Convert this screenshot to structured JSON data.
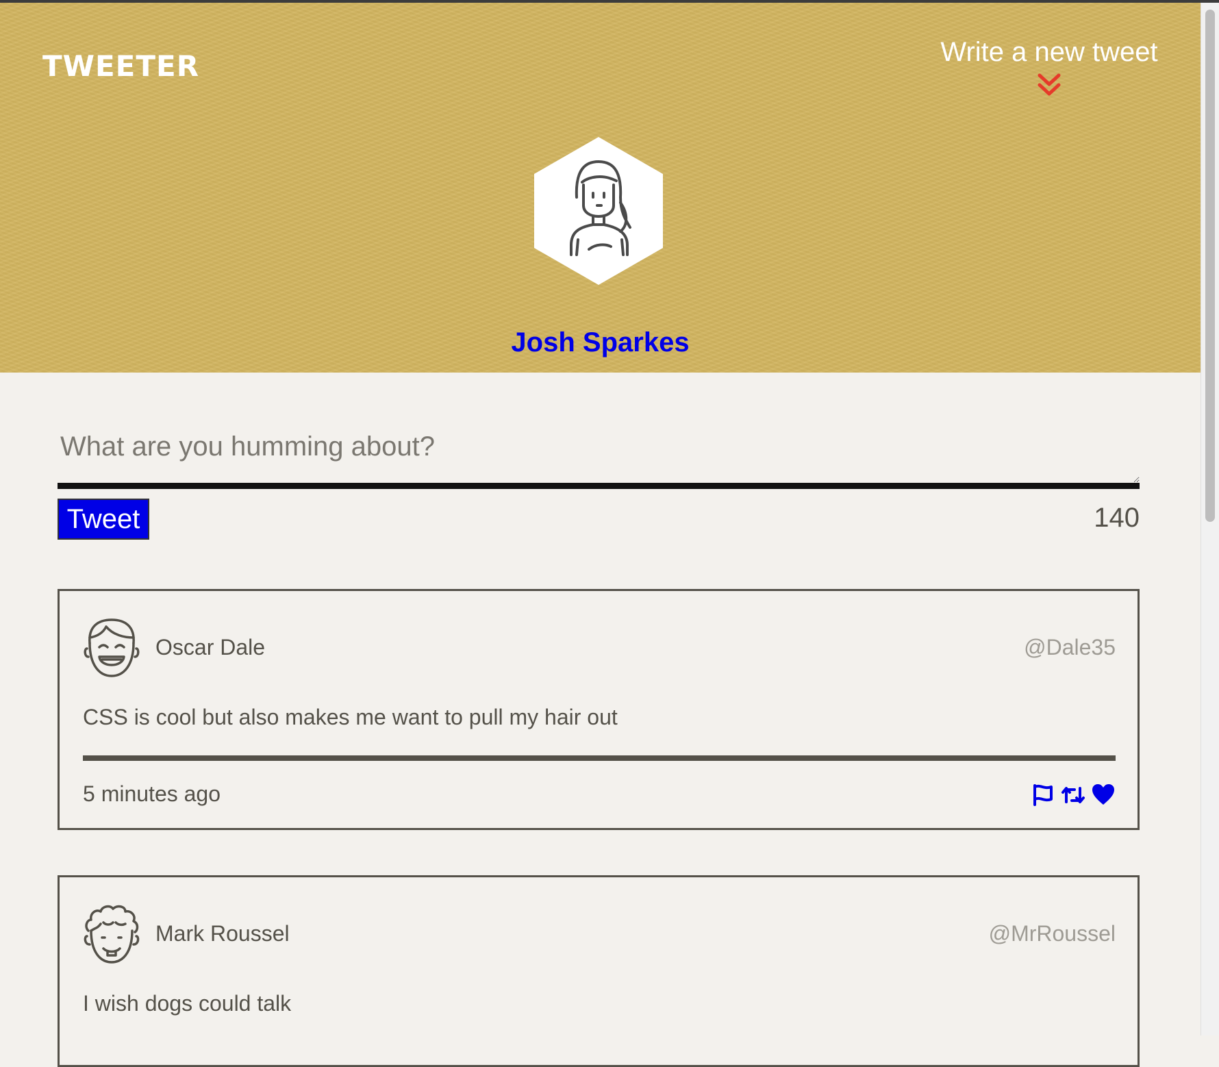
{
  "app": {
    "logo": "TWEETER",
    "nav": {
      "write_new_label": "Write a new tweet",
      "toggle_icon": "chevrons-down-icon"
    }
  },
  "profile": {
    "name": "Josh Sparkes",
    "avatar_icon": "woman-avatar-icon"
  },
  "composer": {
    "placeholder": "What are you humming about?",
    "value": "",
    "submit_label": "Tweet",
    "char_counter": "140"
  },
  "tweets": [
    {
      "avatar_icon": "smiling-man-avatar-icon",
      "name": "Oscar Dale",
      "handle": "@Dale35",
      "content": "CSS is cool but also makes me want to pull my hair out",
      "time": "5 minutes ago",
      "actions": [
        "flag-icon",
        "retweet-icon",
        "heart-icon"
      ]
    },
    {
      "avatar_icon": "curly-hair-man-avatar-icon",
      "name": "Mark Roussel",
      "handle": "@MrRoussel",
      "content": "I wish dogs could talk"
    }
  ],
  "colors": {
    "banner": "#d2b560",
    "accent_blue": "#0000e6",
    "chevron_red": "#e53b2a",
    "page_bg": "#f3f1ed",
    "text": "#545149",
    "handle_text": "#9e9b94"
  }
}
